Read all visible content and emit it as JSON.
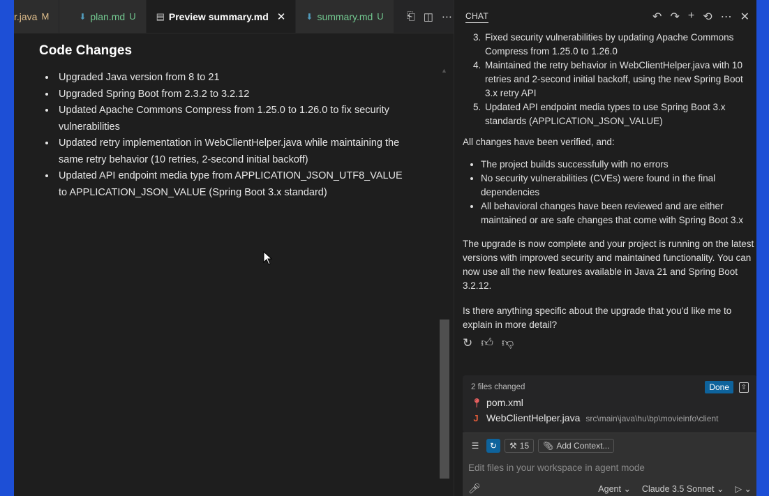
{
  "tabs": [
    {
      "name": "r.java",
      "badge": "M",
      "kind": "java",
      "active": false
    },
    {
      "name": "plan.md",
      "badge": "U",
      "kind": "md",
      "active": false
    },
    {
      "name": "Preview summary.md",
      "badge": "",
      "kind": "preview",
      "active": true
    },
    {
      "name": "summary.md",
      "badge": "U",
      "kind": "md",
      "active": false
    }
  ],
  "editor": {
    "heading": "Code Changes",
    "items": [
      "Upgraded Java version from 8 to 21",
      "Upgraded Spring Boot from 2.3.2 to 3.2.12",
      "Updated Apache Commons Compress from 1.25.0 to 1.26.0 to fix security vulnerabilities",
      "Updated retry implementation in WebClientHelper.java while maintaining the same retry behavior (10 retries, 2-second initial backoff)",
      "Updated API endpoint media type from APPLICATION_JSON_UTF8_VALUE to APPLICATION_JSON_VALUE (Spring Boot 3.x standard)"
    ]
  },
  "chat": {
    "title": "CHAT",
    "steps": [
      "Fixed security vulnerabilities by updating Apache Commons Compress from 1.25.0 to 1.26.0",
      "Maintained the retry behavior in WebClientHelper.java with 10 retries and 2-second initial backoff, using the new Spring Boot 3.x retry API",
      "Updated API endpoint media types to use Spring Boot 3.x standards (APPLICATION_JSON_VALUE)"
    ],
    "verified_intro": "All changes have been verified, and:",
    "verified": [
      "The project builds successfully with no errors",
      "No security vulnerabilities (CVEs) were found in the final dependencies",
      "All behavioral changes have been reviewed and are either maintained or are safe changes that come with Spring Boot 3.x"
    ],
    "summary": "The upgrade is now complete and your project is running on the latest versions with improved security and maintained functionality. You can now use all the new features available in Java 21 and Spring Boot 3.2.12.",
    "question": "Is there anything specific about the upgrade that you'd like me to explain in more detail?",
    "changes": {
      "label": "2 files changed",
      "done": "Done",
      "files": [
        {
          "name": "pom.xml",
          "path": ""
        },
        {
          "name": "WebClientHelper.java",
          "path": "src\\main\\java\\hu\\bp\\movieinfo\\client"
        }
      ]
    },
    "input": {
      "tool_count": "15",
      "add_context": "Add Context...",
      "placeholder": "Edit files in your workspace in agent mode",
      "mode": "Agent",
      "model": "Claude 3.5 Sonnet"
    }
  },
  "colors": {
    "accent": "#0e639c",
    "background": "#1e1e1e",
    "outer": "#1d4fd6"
  }
}
